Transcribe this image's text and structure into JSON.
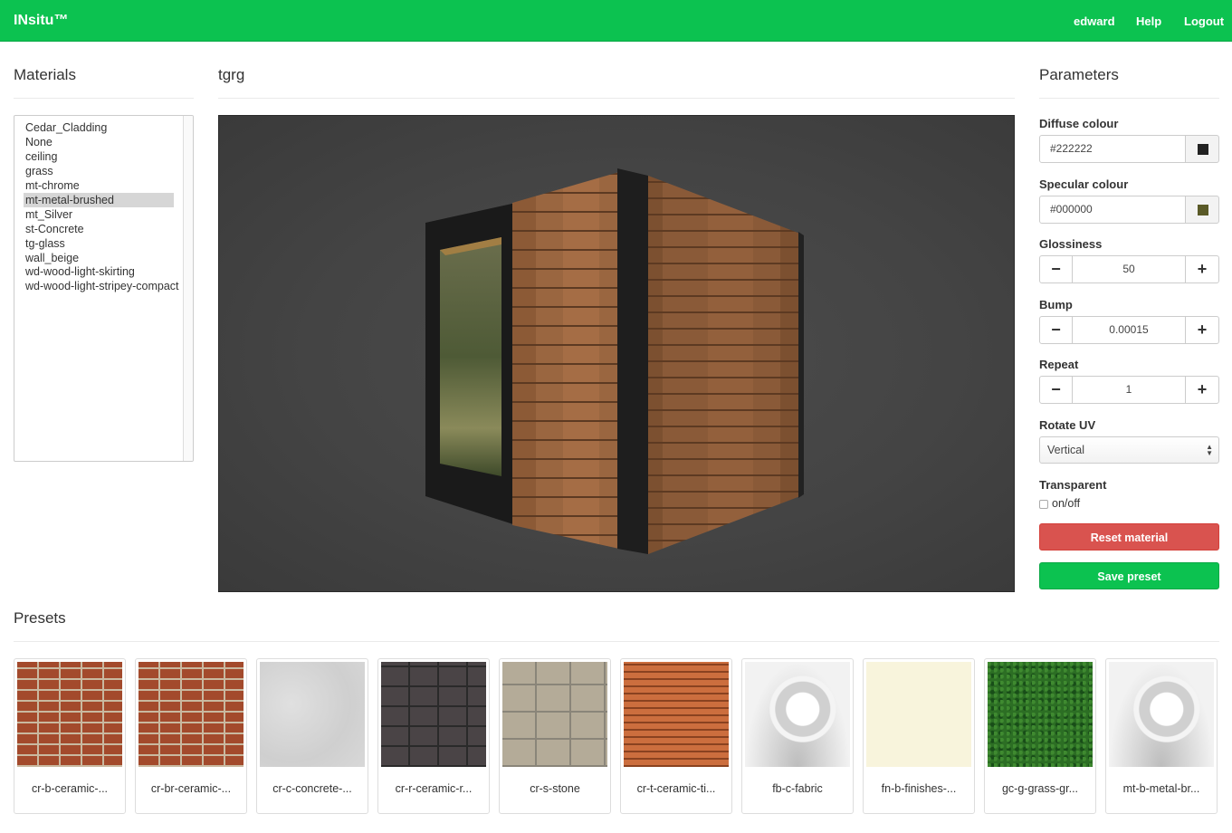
{
  "navbar": {
    "brand": "INsitu™",
    "user": "edward",
    "help": "Help",
    "logout": "Logout"
  },
  "materials": {
    "title": "Materials",
    "items": [
      "Cedar_Cladding",
      "None",
      "ceiling",
      "grass",
      "mt-chrome",
      "mt-metal-brushed",
      "mt_Silver",
      "st-Concrete",
      "tg-glass",
      "wall_beige",
      "wd-wood-light-skirting",
      "wd-wood-light-stripey-compact"
    ],
    "selected": "mt-metal-brushed"
  },
  "viewer": {
    "title": "tgrg"
  },
  "parameters": {
    "title": "Parameters",
    "diffuse": {
      "label": "Diffuse colour",
      "value": "#222222",
      "swatch": "#222222"
    },
    "specular": {
      "label": "Specular colour",
      "value": "#000000",
      "swatch": "#5a5a28"
    },
    "glossiness": {
      "label": "Glossiness",
      "value": "50",
      "minus": "−",
      "plus": "+"
    },
    "bump": {
      "label": "Bump",
      "value": "0.00015",
      "minus": "−",
      "plus": "+"
    },
    "repeat": {
      "label": "Repeat",
      "value": "1",
      "minus": "−",
      "plus": "+"
    },
    "rotate_uv": {
      "label": "Rotate UV",
      "value": "Vertical"
    },
    "transparent": {
      "label": "Transparent",
      "option": "on/off"
    },
    "reset_label": "Reset material",
    "save_label": "Save preset"
  },
  "presets": {
    "title": "Presets",
    "items": [
      {
        "name": "cr-b-ceramic-...",
        "thumb": "brick"
      },
      {
        "name": "cr-br-ceramic-...",
        "thumb": "brick"
      },
      {
        "name": "cr-c-concrete-...",
        "thumb": "concrete"
      },
      {
        "name": "cr-r-ceramic-r...",
        "thumb": "roof-tile"
      },
      {
        "name": "cr-s-stone",
        "thumb": "stone"
      },
      {
        "name": "cr-t-ceramic-ti...",
        "thumb": "terracotta"
      },
      {
        "name": "fb-c-fabric",
        "thumb": "preview-sphere"
      },
      {
        "name": "fn-b-finishes-...",
        "thumb": "cream"
      },
      {
        "name": "gc-g-grass-gr...",
        "thumb": "grass"
      },
      {
        "name": "mt-b-metal-br...",
        "thumb": "preview-sphere"
      }
    ]
  },
  "colors": {
    "navbar": "#0cc250",
    "danger": "#d9534f",
    "success": "#0cc250"
  }
}
